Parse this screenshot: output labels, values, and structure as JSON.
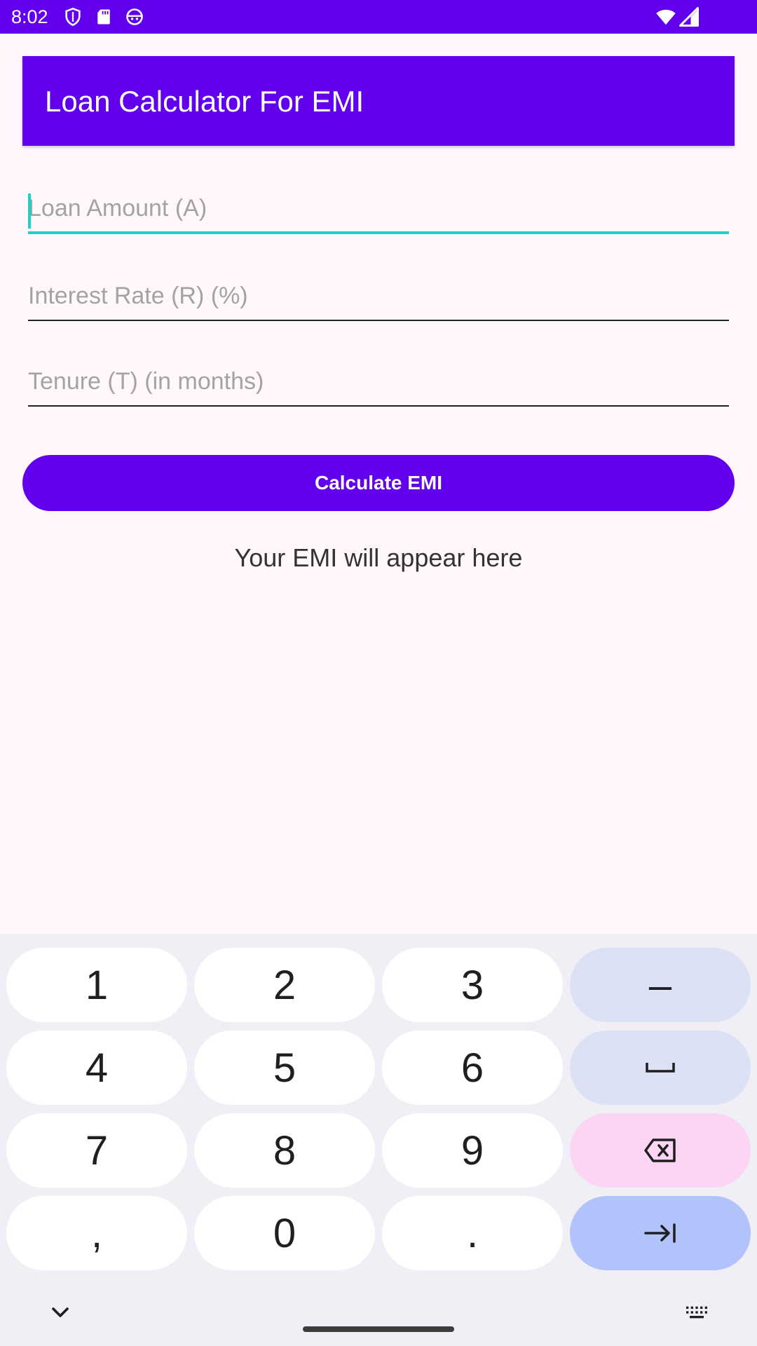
{
  "status_bar": {
    "time": "8:02",
    "icons": [
      "shield-icon",
      "sd-card-icon",
      "android-face-icon",
      "wifi-icon",
      "cell-signal-icon"
    ]
  },
  "app_bar": {
    "title": "Loan Calculator For EMI"
  },
  "form": {
    "loan_amount": {
      "placeholder": "Loan Amount (A)",
      "value": ""
    },
    "interest_rate": {
      "placeholder": "Interest Rate (R) (%)",
      "value": ""
    },
    "tenure": {
      "placeholder": "Tenure (T) (in months)",
      "value": ""
    },
    "calculate_label": "Calculate EMI",
    "result_text": "Your EMI will appear here"
  },
  "keyboard": {
    "keys": [
      "1",
      "2",
      "3",
      "–",
      "4",
      "5",
      "6",
      "7",
      "8",
      "9",
      ",",
      "0",
      "."
    ],
    "icons": [
      "space-icon",
      "backspace-icon",
      "tab-next-icon",
      "collapse-keyboard-icon",
      "keyboard-switch-icon"
    ]
  },
  "colors": {
    "primary": "#6200EE",
    "accent": "#1ED1C4",
    "background": "#FFF7FC",
    "keyboard_bg": "#F0EFF6",
    "key_func": "#DDE1F5",
    "key_delete": "#FCD5F4",
    "key_go": "#B1C3FA"
  }
}
